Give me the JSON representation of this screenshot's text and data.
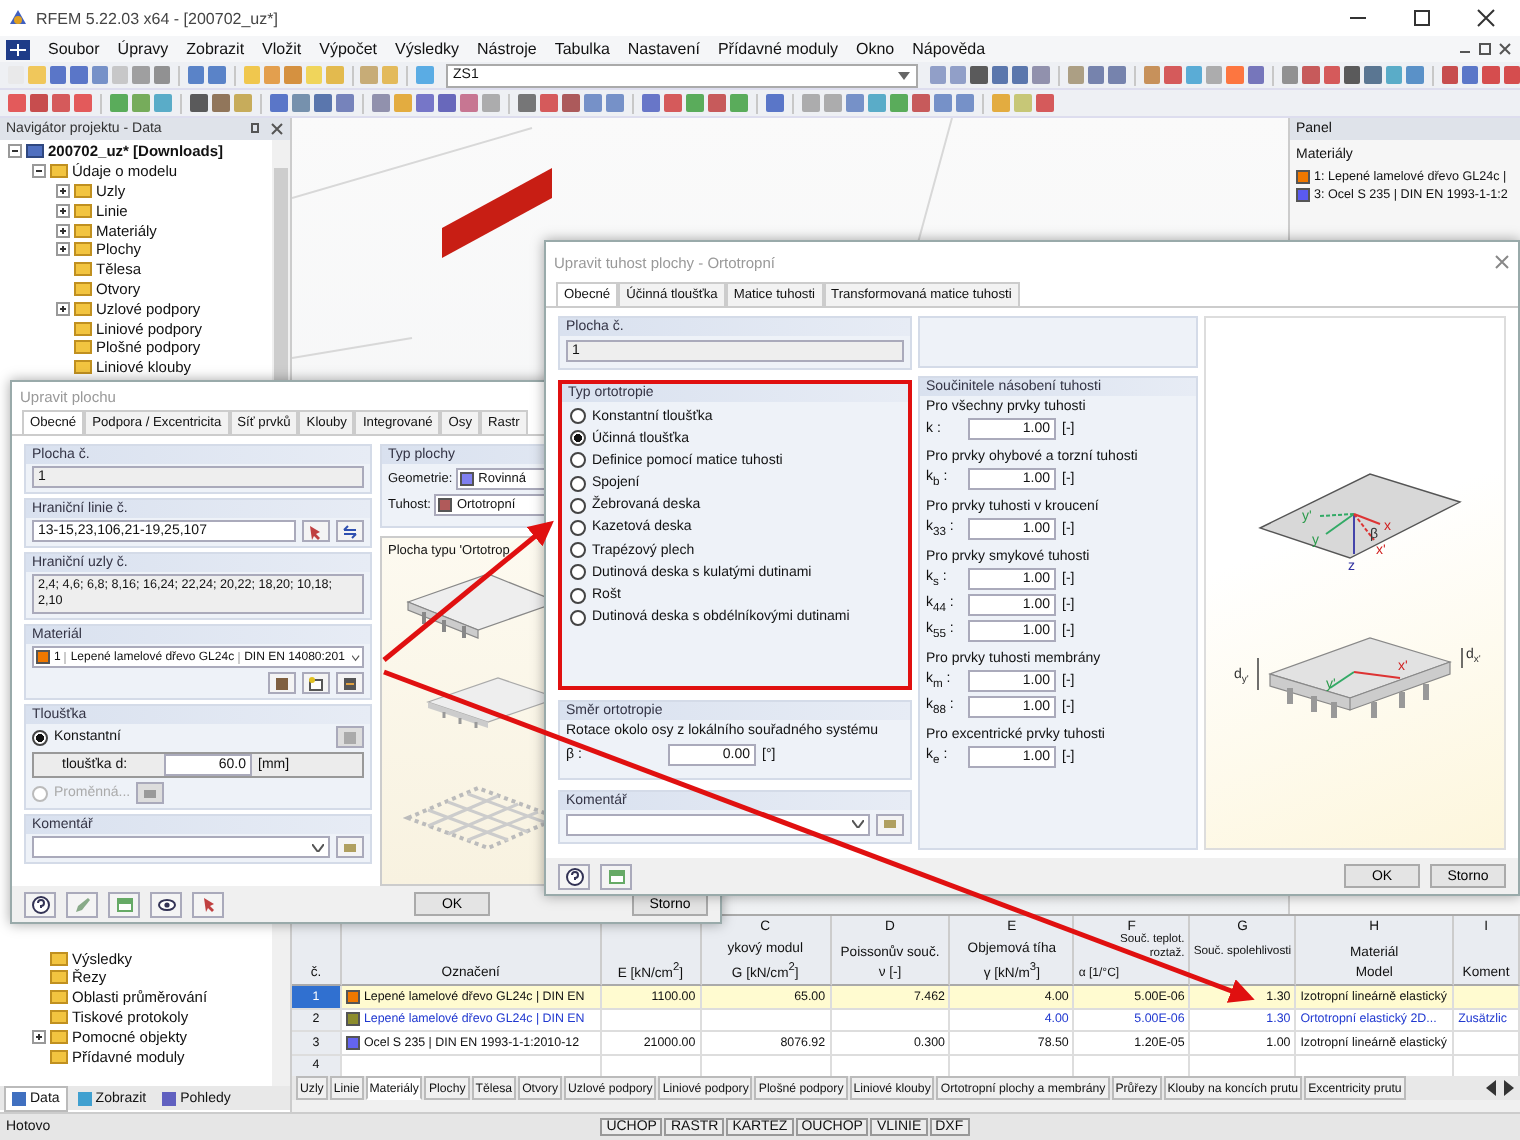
{
  "window": {
    "title": "RFEM 5.22.03 x64 - [200702_uz*]"
  },
  "menu": [
    "Soubor",
    "Úpravy",
    "Zobrazit",
    "Vložit",
    "Výpočet",
    "Výsledky",
    "Nástroje",
    "Tabulka",
    "Nastavení",
    "Přídavné moduly",
    "Okno",
    "Nápověda"
  ],
  "toolbar": {
    "load_case": "ZS1"
  },
  "navigator": {
    "title": "Navigátor projektu - Data",
    "tree": [
      {
        "label": "200702_uz* [Downloads]",
        "expanded": true,
        "children": [
          {
            "label": "Údaje o modelu",
            "expanded": true,
            "children": [
              {
                "label": "Uzly",
                "expanded": false
              },
              {
                "label": "Linie",
                "expanded": false
              },
              {
                "label": "Materiály",
                "expanded": false
              },
              {
                "label": "Plochy",
                "expanded": false
              },
              {
                "label": "Tělesa"
              },
              {
                "label": "Otvory"
              },
              {
                "label": "Uzlové podpory",
                "expanded": false
              },
              {
                "label": "Liniové podpory"
              },
              {
                "label": "Plošné podpory"
              },
              {
                "label": "Liniové klouby"
              }
            ]
          },
          {
            "label": "Výsledky"
          },
          {
            "label": "Řezy"
          },
          {
            "label": "Oblasti průměrování"
          },
          {
            "label": "Tiskové protokoly"
          },
          {
            "label": "Pomocné objekty",
            "expanded": false
          },
          {
            "label": "Přídavné moduly"
          }
        ]
      }
    ],
    "tabs": [
      {
        "label": "Data",
        "selected": true
      },
      {
        "label": "Zobrazit",
        "selected": false
      },
      {
        "label": "Pohledy",
        "selected": false
      }
    ]
  },
  "panel": {
    "title": "Panel",
    "heading": "Materiály",
    "items": [
      {
        "label": "1: Lepené lamelové dřevo GL24c |",
        "color": "#f07800"
      },
      {
        "label": "3: Ocel S 235 | DIN EN 1993-1-1:2",
        "color": "#5a5af0"
      }
    ]
  },
  "table": {
    "columns": [
      {
        "line2": "č."
      },
      {
        "line2": "Označení"
      },
      {
        "line2": "E [kN/cm$^{2}$]"
      },
      {
        "letter": "C",
        "line1": "ykový modul",
        "line2": "G [kN/cm$^{2}$]"
      },
      {
        "letter": "D",
        "line1": "Poissonův souč.",
        "line2": "ν [-]"
      },
      {
        "letter": "E",
        "line1": "Objemová tíha",
        "line2": "γ [kN/m$^{3}$]"
      },
      {
        "letter": "F",
        "line1": "Souč. teplot. roztaž.",
        "line2": "α [1/°C]"
      },
      {
        "letter": "G",
        "line1": "Souč. spolehlivosti"
      },
      {
        "letter": "H",
        "line1": "Materiál",
        "line2": "Model"
      },
      {
        "letter": "I",
        "line2": "Koment"
      }
    ],
    "rows": [
      {
        "selected": true,
        "inherited": false,
        "color": "#f07800",
        "cells": [
          "1",
          "Lepené lamelové dřevo GL24c | DIN EN",
          "1100.00",
          "65.00",
          "7.462",
          "4.00",
          "5.00E-06",
          "1.30",
          "Izotropní lineárně elastický",
          ""
        ]
      },
      {
        "selected": false,
        "inherited": true,
        "color": "#8c8c2c",
        "cells": [
          "2",
          "Lepené lamelové dřevo GL24c | DIN EN",
          "",
          "",
          "",
          "4.00",
          "5.00E-06",
          "1.30",
          "Ortotropní elastický 2D...",
          "Zusätzlic"
        ]
      },
      {
        "selected": false,
        "inherited": false,
        "color": "#6464f0",
        "cells": [
          "3",
          "Ocel S 235 | DIN EN 1993-1-1:2010-12",
          "21000.00",
          "8076.92",
          "0.300",
          "78.50",
          "1.20E-05",
          "1.00",
          "Izotropní lineárně elastický",
          ""
        ]
      },
      {
        "selected": false,
        "cells": [
          "4"
        ]
      }
    ]
  },
  "sheet_tabs": [
    {
      "label": "Uzly",
      "selected": false
    },
    {
      "label": "Linie",
      "selected": false
    },
    {
      "label": "Materiály",
      "selected": true
    },
    {
      "label": "Plochy",
      "selected": false
    },
    {
      "label": "Tělesa",
      "selected": false
    },
    {
      "label": "Otvory",
      "selected": false
    },
    {
      "label": "Uzlové podpory",
      "selected": false
    },
    {
      "label": "Liniové podpory",
      "selected": false
    },
    {
      "label": "Plošné podpory",
      "selected": false
    },
    {
      "label": "Liniové klouby",
      "selected": false
    },
    {
      "label": "Ortotropní plochy a membrány",
      "selected": false
    },
    {
      "label": "Průřezy",
      "selected": false
    },
    {
      "label": "Klouby na koncích prutu",
      "selected": false
    },
    {
      "label": "Excentricity prutu",
      "selected": false
    }
  ],
  "status_bar": {
    "text": "Hotovo",
    "indicators": [
      "UCHOP",
      "RASTR",
      "KARTEZ",
      "OUCHOP",
      "VLINIE",
      "DXF"
    ]
  },
  "surface_dialog": {
    "title": "Upravit plochu",
    "tabs": [
      {
        "label": "Obecné",
        "selected": true
      },
      {
        "label": "Podpora / Excentricita",
        "selected": false
      },
      {
        "label": "Síť prvků",
        "selected": false
      },
      {
        "label": "Klouby",
        "selected": false
      },
      {
        "label": "Integrované",
        "selected": false
      },
      {
        "label": "Osy",
        "selected": false
      },
      {
        "label": "Rastr",
        "selected": false
      }
    ],
    "number_label": "Plocha č.",
    "number": "1",
    "lines_label": "Hraniční linie č.",
    "lines": "13-15,23,106,21-19,25,107",
    "nodes_label": "Hraniční uzly č.",
    "nodes": "2,4; 4,6; 6,8; 8,16; 16,24; 22,24; 20,22; 18,20; 10,18; 2,10",
    "material": {
      "label": "Materiál",
      "color": "#f07800",
      "number": "1",
      "name": "Lepené lamelové dřevo GL24c",
      "standard": "DIN EN 14080:201"
    },
    "thickness": {
      "label": "Tloušťka",
      "options": [
        {
          "label": "Konstantní",
          "selected": true,
          "disabled": false
        },
        {
          "label": "Proměnná...",
          "selected": false,
          "disabled": true
        }
      ],
      "field_label": "tloušťka d:",
      "value": "60.0",
      "unit": "[mm]"
    },
    "comment_label": "Komentář",
    "type": {
      "label": "Typ plochy",
      "geometry_label": "Geometrie:",
      "geometry": "Rovinná",
      "stiffness_label": "Tuhost:",
      "stiffness": "Ortotropní"
    },
    "preview_caption": "Plocha typu 'Ortotrop",
    "buttons": [
      "OK",
      "Storno"
    ]
  },
  "stiffness_dialog": {
    "title": "Upravit tuhost plochy - Ortotropní",
    "tabs": [
      {
        "label": "Obecné",
        "selected": true
      },
      {
        "label": "Účinná tloušťka",
        "selected": false
      },
      {
        "label": "Matice tuhosti",
        "selected": false
      },
      {
        "label": "Transformovaná matice tuhosti",
        "selected": false
      }
    ],
    "number_label": "Plocha č.",
    "number": "1",
    "orthotropy": {
      "label": "Typ ortotropie",
      "options": [
        {
          "label": "Konstantní tloušťka",
          "selected": false
        },
        {
          "label": "Účinná tloušťka",
          "selected": true
        },
        {
          "label": "Definice pomocí matice tuhosti",
          "selected": false
        },
        {
          "label": "Spojení",
          "selected": false
        },
        {
          "label": "Žebrovaná deska",
          "selected": false
        },
        {
          "label": "Kazetová deska",
          "selected": false
        },
        {
          "label": "Trapézový plech",
          "selected": false
        },
        {
          "label": "Dutinová deska s kulatými dutinami",
          "selected": false
        },
        {
          "label": "Rošt",
          "selected": false
        },
        {
          "label": "Dutinová deska s obdélníkovými dutinami",
          "selected": false
        }
      ]
    },
    "direction": {
      "label": "Směr ortotropie",
      "text": "Rotace okolo osy z lokálního souřadného systému",
      "field_label": "β :",
      "value": "0.00",
      "unit": "[°]"
    },
    "comment_label": "Komentář",
    "factors": {
      "label": "Součinitele násobení tuhosti",
      "groups": [
        {
          "title": "Pro všechny prvky tuhosti",
          "fields": [
            {
              "label": "k :",
              "value": "1.00",
              "unit": "[-]"
            }
          ]
        },
        {
          "title": "Pro prvky ohybové a torzní tuhosti",
          "fields": [
            {
              "label": "k$_{b}$ :",
              "value": "1.00",
              "unit": "[-]"
            }
          ]
        },
        {
          "title": "Pro prvky tuhosti v kroucení",
          "fields": [
            {
              "label": "k$_{33}$ :",
              "value": "1.00",
              "unit": "[-]"
            }
          ]
        },
        {
          "title": "Pro prvky smykové tuhosti",
          "fields": [
            {
              "label": "k$_{s}$ :",
              "value": "1.00",
              "unit": "[-]"
            },
            {
              "label": "k$_{44}$ :",
              "value": "1.00",
              "unit": "[-]"
            },
            {
              "label": "k$_{55}$ :",
              "value": "1.00",
              "unit": "[-]"
            }
          ]
        },
        {
          "title": "Pro prvky tuhosti membrány",
          "fields": [
            {
              "label": "k$_{m}$ :",
              "value": "1.00",
              "unit": "[-]"
            },
            {
              "label": "k$_{88}$ :",
              "value": "1.00",
              "unit": "[-]"
            }
          ]
        },
        {
          "title": "Pro excentrické prvky tuhosti",
          "fields": [
            {
              "label": "k$_{e}$ :",
              "value": "1.00",
              "unit": "[-]"
            }
          ]
        }
      ]
    },
    "diagram_labels": [
      {
        "text": "y'"
      },
      {
        "text": "y"
      },
      {
        "text": "β"
      },
      {
        "text": "x"
      },
      {
        "text": "x'"
      },
      {
        "text": "z"
      },
      {
        "text": "y'"
      },
      {
        "text": "x'"
      },
      {
        "text": "d",
        "sub": "y'"
      },
      {
        "text": "d",
        "sub": "x'"
      }
    ],
    "buttons": [
      "OK",
      "Storno"
    ]
  }
}
